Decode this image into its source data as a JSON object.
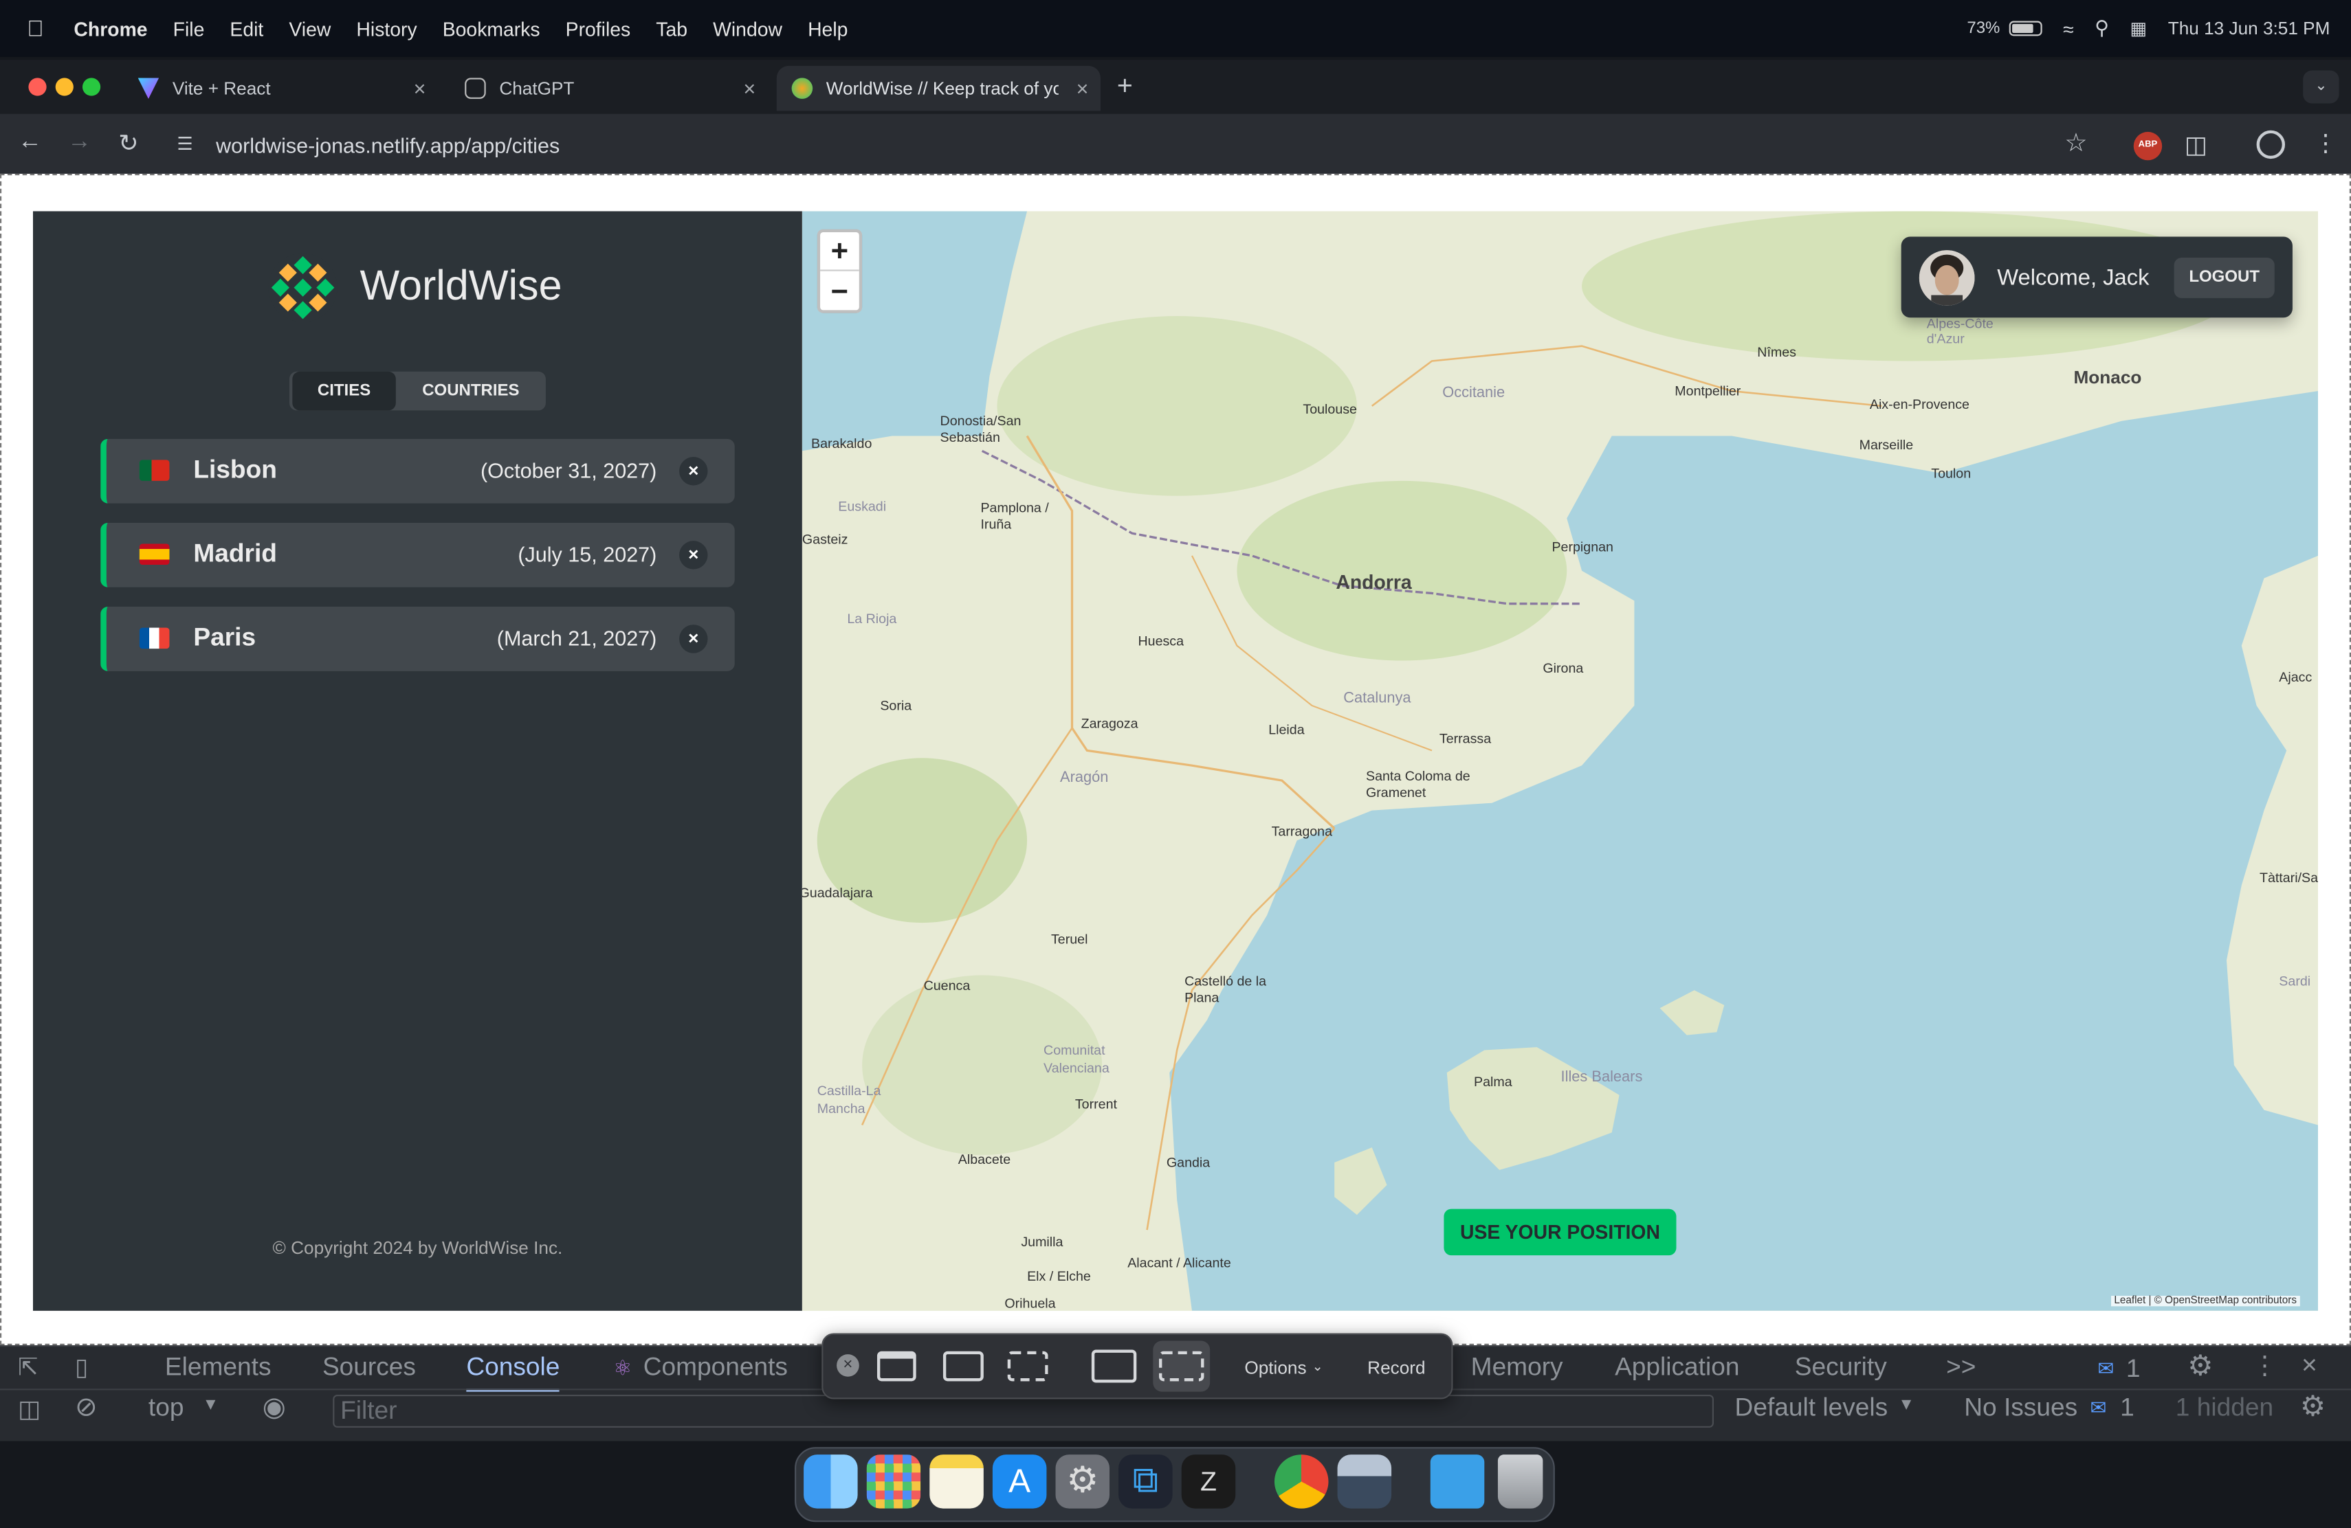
{
  "menubar": {
    "app": "Chrome",
    "items": [
      "File",
      "Edit",
      "View",
      "History",
      "Bookmarks",
      "Profiles",
      "Tab",
      "Window",
      "Help"
    ],
    "battery": "73%",
    "datetime": "Thu 13 Jun  3:51 PM"
  },
  "browser": {
    "tabs": [
      {
        "title": "Vite + React"
      },
      {
        "title": "ChatGPT"
      },
      {
        "title": "WorldWise // Keep track of yo"
      }
    ],
    "url": "worldwise-jonas.netlify.app/app/cities",
    "extension_badge": "ABP"
  },
  "app": {
    "logo_text": "WorldWise",
    "nav": {
      "cities": "CITIES",
      "countries": "COUNTRIES"
    },
    "cities": [
      {
        "flag": "🇵🇹",
        "name": "Lisbon",
        "date": "(October 31, 2027)"
      },
      {
        "flag": "🇪🇸",
        "name": "Madrid",
        "date": "(July 15, 2027)"
      },
      {
        "flag": "🇫🇷",
        "name": "Paris",
        "date": "(March 21, 2027)"
      }
    ],
    "delete_symbol": "×",
    "copyright": "© Copyright 2024 by WorldWise Inc."
  },
  "map": {
    "zoom_in": "+",
    "zoom_out": "−",
    "welcome": "Welcome, Jack",
    "logout": "LOGOUT",
    "use_position": "USE YOUR POSITION",
    "attribution": "Leaflet | © OpenStreetMap contributors",
    "labels": {
      "andorra": "Andorra",
      "monaco": "Monaco",
      "toulouse": "Toulouse",
      "montpellier": "Montpellier",
      "nimes": "Nîmes",
      "marseille": "Marseille",
      "toulon": "Toulon",
      "aix": "Aix-en-Provence",
      "occitanie": "Occitanie",
      "perpignan": "Perpignan",
      "girona": "Girona",
      "huesca": "Huesca",
      "zaragoza": "Zaragoza",
      "lleida": "Lleida",
      "catalunya": "Catalunya",
      "terrassa": "Terrassa",
      "santa_coloma": "Santa Coloma de Gramenet",
      "tarragona": "Tarragona",
      "soria": "Soria",
      "aragon": "Aragón",
      "teruel": "Teruel",
      "cuenca": "Cuenca",
      "castello": "Castelló de la Plana",
      "valenciana": "Comunitat Valenciana",
      "torrent": "Torrent",
      "gandia": "Gandia",
      "albacete": "Albacete",
      "alacant": "Alacant / Alicante",
      "jumilla": "Jumilla",
      "elx": "Elx / Elche",
      "orihuela": "Orihuela",
      "palma": "Palma",
      "illes_balears": "Illes Balears",
      "castilla": "Castilla-La Mancha",
      "barakaldo": "Barakaldo",
      "donostia": "Donostia/San Sebastián",
      "pamplona": "Pamplona / Iruña",
      "euskadi": "Euskadi",
      "la_rioja": "La Rioja",
      "gasteiz": "Gasteiz",
      "guadalajara": "Guadalajara",
      "tattari": "Tàttari/Sassari",
      "ajaccio": "Ajacc",
      "alpes": "Alpes-Côte d'Azur",
      "sardi": "Sardi"
    }
  },
  "devtools": {
    "tabs": [
      "Elements",
      "Sources",
      "Console",
      "Components",
      "Memory",
      "Application",
      "Security"
    ],
    "more": ">>",
    "badge": "1",
    "context": "top",
    "filter_placeholder": "Filter",
    "levels": "Default levels",
    "issues": "No Issues",
    "issues_count": "1",
    "hidden": "1 hidden"
  },
  "capture_toolbar": {
    "options": "Options",
    "record": "Record"
  },
  "colors": {
    "brand_green": "#00c46a",
    "sidebar": "#2d3439",
    "card": "#42484d",
    "sea": "#aad3df"
  }
}
